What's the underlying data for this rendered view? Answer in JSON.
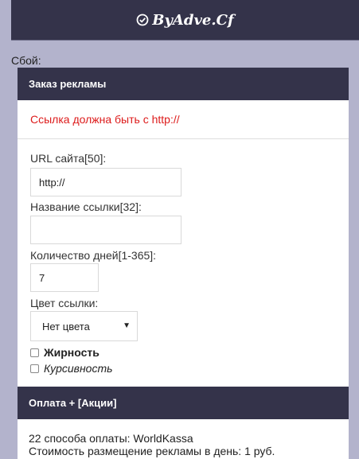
{
  "header": {
    "brand": "ByAdve.Cf",
    "brand_icon": "check-circle-icon"
  },
  "error_label": "Сбой:",
  "order_panel": {
    "title": "Заказ рекламы",
    "notice": "Ссылка должна быть с http://",
    "url_label": "URL сайта[50]:",
    "url_value": "http://",
    "name_label": "Название ссылки[32]:",
    "name_value": "",
    "days_label": "Количество дней[1-365]:",
    "days_value": "7",
    "color_label": "Цвет ссылки:",
    "color_selected": "Нет цвета",
    "bold_label": "Жирность",
    "italic_label": "Курсивность",
    "bold_checked": false,
    "italic_checked": false
  },
  "payment_panel": {
    "title": "Оплата + [Акции]",
    "line1": "22 способа оплаты: WorldKassa",
    "line2": "Стоимость размещение рекламы в день: 1 руб."
  },
  "colors": {
    "header_bg": "#34334a",
    "page_bg": "#b3b3cc",
    "notice_red": "#dd1b1b"
  }
}
